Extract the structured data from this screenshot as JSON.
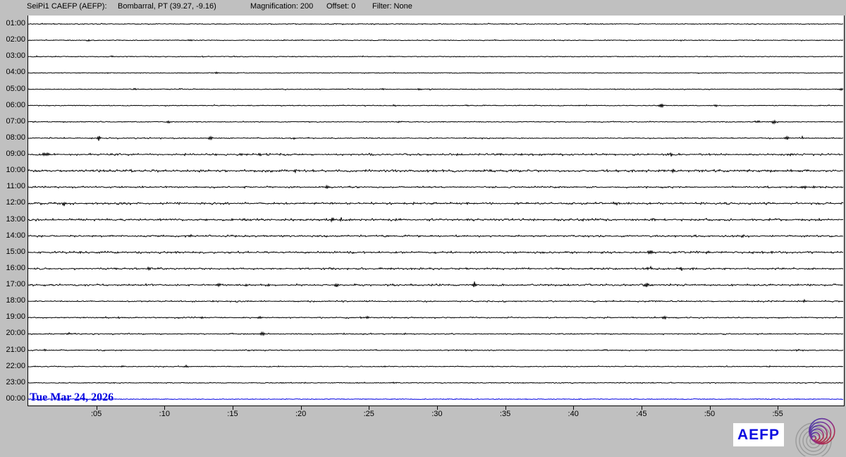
{
  "header": {
    "station": "SeiPi1 CAEFP (AEFP):",
    "location": "Bombarral, PT (39.27, -9.16)",
    "magnification_label": "Magnification: 200",
    "offset_label": "Offset: 0",
    "filter_label": "Filter: None"
  },
  "footer": {
    "date_label": "Tue Mar 24, 2026",
    "logo_text": "AEFP"
  },
  "colors": {
    "background": "#c0c0c0",
    "plot_background": "#ffffff",
    "trace": "#000000",
    "current_day": "#0000e0",
    "logo_blue": "#0b0be0"
  },
  "chart_data": {
    "type": "line",
    "subtype": "helicorder-24h",
    "x_range_minutes": [
      0,
      60
    ],
    "tick_interval_minutes": 5,
    "x_tick_labels": [
      ":05",
      ":10",
      ":15",
      ":20",
      ":25",
      ":30",
      ":35",
      ":40",
      ":45",
      ":50",
      ":55"
    ],
    "trace_color": "#000000",
    "active_row_color": "#0000e0",
    "rows": [
      {
        "label": "01:00",
        "noise": 0.5,
        "density": 0.05,
        "events": [
          [
            19.5,
            1.0,
            2.5
          ]
        ]
      },
      {
        "label": "02:00",
        "noise": 0.5,
        "density": 0.06,
        "events": [
          [
            4.5,
            1.0,
            2.5
          ],
          [
            11.8,
            1.0,
            2.5
          ]
        ]
      },
      {
        "label": "03:00",
        "noise": 0.45,
        "density": 0.04,
        "events": [
          [
            6.2,
            0.8,
            2.5
          ]
        ]
      },
      {
        "label": "04:00",
        "noise": 0.45,
        "density": 0.05,
        "events": [
          [
            13.9,
            1.0,
            2.5
          ]
        ]
      },
      {
        "label": "05:00",
        "noise": 0.5,
        "density": 0.06,
        "events": [
          [
            7.8,
            1.0,
            2.5
          ],
          [
            25.9,
            1.0,
            2.5
          ],
          [
            28.7,
            1.0,
            2.5
          ],
          [
            59.6,
            2.0,
            2.0
          ]
        ]
      },
      {
        "label": "06:00",
        "noise": 0.5,
        "density": 0.07,
        "events": [
          [
            26.9,
            1.0,
            2.5
          ],
          [
            30.0,
            1.2,
            2.5
          ],
          [
            32.1,
            1.1,
            2.5
          ],
          [
            33.4,
            1.2,
            2.5
          ],
          [
            46.4,
            2.2,
            3.0
          ],
          [
            50.4,
            1.0,
            2.5
          ]
        ]
      },
      {
        "label": "07:00",
        "noise": 0.5,
        "density": 0.07,
        "events": [
          [
            10.3,
            1.0,
            2.5
          ],
          [
            27.2,
            1.0,
            2.5
          ],
          [
            53.6,
            1.8,
            2.5
          ],
          [
            54.7,
            2.2,
            2.0
          ]
        ]
      },
      {
        "label": "08:00",
        "noise": 0.6,
        "density": 0.12,
        "events": [
          [
            5.2,
            3.0,
            1.8
          ],
          [
            13.4,
            3.4,
            1.8
          ],
          [
            19.6,
            3.0,
            1.8
          ],
          [
            38.5,
            1.2,
            2.5
          ],
          [
            55.7,
            1.8,
            2.5
          ],
          [
            56.8,
            2.2,
            2.0
          ]
        ]
      },
      {
        "label": "09:00",
        "noise": 0.8,
        "density": 0.45,
        "events": [
          [
            1.1,
            4.0,
            1.6
          ],
          [
            1.5,
            1.6,
            4.0
          ],
          [
            15.8,
            1.5,
            4.0
          ],
          [
            47.0,
            1.6,
            4.0
          ],
          [
            56.0,
            1.3,
            4.0
          ]
        ]
      },
      {
        "label": "10:00",
        "noise": 0.9,
        "density": 0.5,
        "events": [
          [
            7.5,
            2.0,
            2.0
          ],
          [
            19.5,
            3.2,
            2.5
          ],
          [
            20.8,
            2.8,
            1.8
          ],
          [
            47.3,
            1.6,
            4.0
          ],
          [
            54.3,
            1.4,
            4.0
          ]
        ]
      },
      {
        "label": "11:00",
        "noise": 0.7,
        "density": 0.35,
        "events": [
          [
            21.9,
            2.0,
            2.5
          ],
          [
            57.0,
            1.8,
            4.0
          ],
          [
            58.0,
            1.4,
            3.0
          ]
        ]
      },
      {
        "label": "12:00",
        "noise": 0.85,
        "density": 0.45,
        "events": [
          [
            2.6,
            3.0,
            1.8
          ],
          [
            32.1,
            1.5,
            2.5
          ],
          [
            43.2,
            1.5,
            2.5
          ]
        ]
      },
      {
        "label": "13:00",
        "noise": 0.85,
        "density": 0.45,
        "events": [
          [
            22.3,
            3.0,
            1.8
          ],
          [
            22.9,
            2.4,
            1.8
          ],
          [
            27.3,
            1.5,
            2.5
          ],
          [
            40.9,
            1.5,
            2.5
          ],
          [
            45.8,
            2.0,
            3.0
          ],
          [
            49.7,
            1.5,
            2.5
          ]
        ]
      },
      {
        "label": "14:00",
        "noise": 0.75,
        "density": 0.4,
        "events": [
          [
            11.9,
            1.5,
            2.5
          ],
          [
            52.5,
            2.0,
            2.5
          ]
        ]
      },
      {
        "label": "15:00",
        "noise": 0.8,
        "density": 0.45,
        "events": [
          [
            1.0,
            2.0,
            2.0
          ],
          [
            45.6,
            2.8,
            3.0
          ],
          [
            49.9,
            2.0,
            2.5
          ]
        ]
      },
      {
        "label": "16:00",
        "noise": 0.75,
        "density": 0.4,
        "events": [
          [
            8.8,
            2.0,
            2.5
          ],
          [
            45.6,
            3.2,
            3.0
          ],
          [
            47.9,
            2.4,
            2.5
          ]
        ]
      },
      {
        "label": "17:00",
        "noise": 0.75,
        "density": 0.4,
        "events": [
          [
            14.0,
            2.4,
            2.0
          ],
          [
            15.5,
            2.0,
            2.5
          ],
          [
            17.6,
            2.0,
            2.5
          ],
          [
            22.6,
            2.0,
            2.0
          ],
          [
            32.8,
            3.6,
            2.5
          ],
          [
            45.3,
            2.4,
            2.5
          ]
        ]
      },
      {
        "label": "18:00",
        "noise": 0.6,
        "density": 0.3,
        "events": [
          [
            13.7,
            3.2,
            1.6
          ],
          [
            53.5,
            1.5,
            2.5
          ],
          [
            56.9,
            1.5,
            2.5
          ]
        ]
      },
      {
        "label": "19:00",
        "noise": 0.55,
        "density": 0.25,
        "events": [
          [
            12.7,
            1.5,
            2.5
          ],
          [
            17.0,
            1.5,
            2.5
          ],
          [
            24.8,
            1.5,
            2.5
          ],
          [
            46.8,
            2.2,
            3.0
          ]
        ]
      },
      {
        "label": "20:00",
        "noise": 0.55,
        "density": 0.25,
        "events": [
          [
            2.9,
            1.5,
            2.5
          ],
          [
            17.2,
            2.4,
            3.0
          ],
          [
            26.9,
            1.5,
            2.5
          ]
        ]
      },
      {
        "label": "21:00",
        "noise": 0.45,
        "density": 0.14,
        "events": [
          [
            1.2,
            1.0,
            2.5
          ],
          [
            21.0,
            1.0,
            2.5
          ],
          [
            56.5,
            1.0,
            2.5
          ]
        ]
      },
      {
        "label": "22:00",
        "noise": 0.45,
        "density": 0.14,
        "events": [
          [
            7.0,
            1.0,
            2.5
          ],
          [
            11.6,
            1.0,
            2.5
          ],
          [
            26.1,
            1.0,
            2.5
          ],
          [
            54.3,
            1.0,
            2.5
          ]
        ]
      },
      {
        "label": "23:00",
        "noise": 0.4,
        "density": 0.12,
        "events": [
          [
            20.2,
            1.2,
            2.5
          ],
          [
            26.9,
            1.2,
            2.5
          ]
        ]
      },
      {
        "label": "00:00",
        "noise": 0,
        "density": 0,
        "events": [],
        "color": "#0000e0"
      }
    ]
  }
}
